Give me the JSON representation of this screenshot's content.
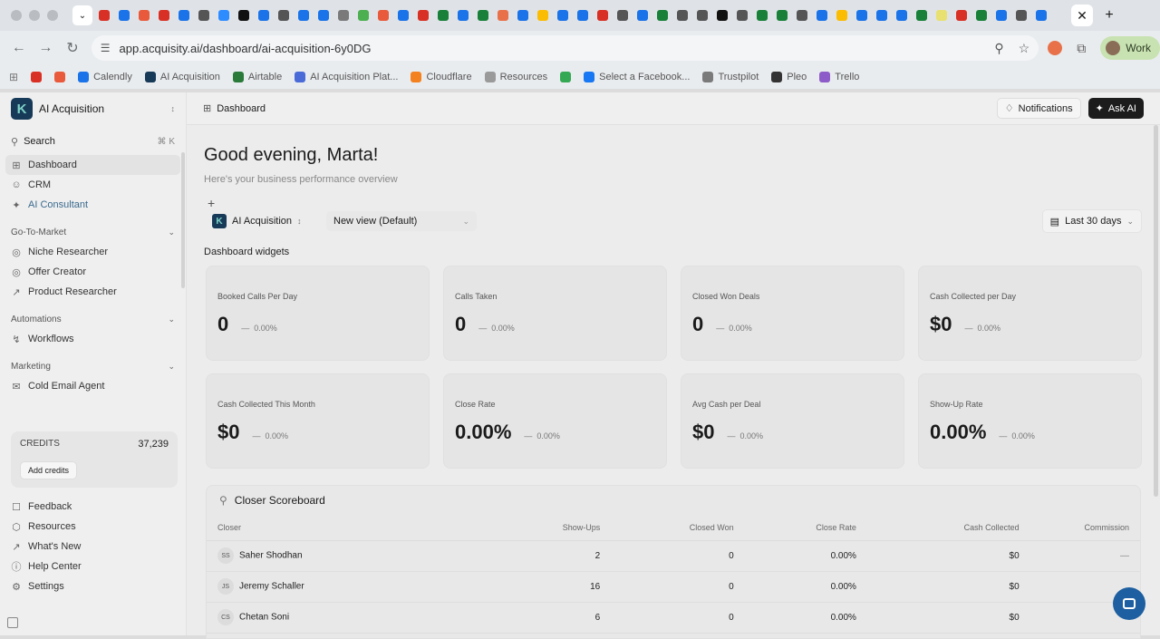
{
  "browser": {
    "tab_colors": [
      "#d93025",
      "#1a73e8",
      "#e85a3b",
      "#d93025",
      "#1a73e8",
      "#555555",
      "#2d8cff",
      "#111111",
      "#1a73e8",
      "#555555",
      "#1a73e8",
      "#1a73e8",
      "#7a7a7a",
      "#4caf50",
      "#e85a3b",
      "#1a73e8",
      "#d93025",
      "#188038",
      "#1a73e8",
      "#188038",
      "#e8714a",
      "#1a73e8",
      "#fbbc04",
      "#1a73e8",
      "#1a73e8",
      "#d93025",
      "#555555",
      "#1a73e8",
      "#188038",
      "#555555",
      "#555555",
      "#111111",
      "#555555",
      "#188038",
      "#188038",
      "#555555",
      "#1a73e8",
      "#fbbc04",
      "#1a73e8",
      "#1a73e8",
      "#1a73e8",
      "#188038",
      "#e8e070",
      "#d93025",
      "#188038",
      "#1a73e8",
      "#555555",
      "#1a73e8"
    ],
    "url": "app.acquisity.ai/dashboard/ai-acquisition-6y0DG",
    "profile_label": "Work",
    "bookmarks": [
      {
        "label": "",
        "color": "#d93025",
        "icon": "gmail-icon"
      },
      {
        "label": "",
        "color": "#e85a3b",
        "icon": "slack-icon"
      },
      {
        "label": "Calendly",
        "color": "#1a73e8",
        "icon": "calendly-icon"
      },
      {
        "label": "AI Acquisition",
        "color": "#173a58",
        "icon": "ai-acquisition-icon"
      },
      {
        "label": "Airtable",
        "color": "#2a7a3a",
        "icon": "airtable-icon"
      },
      {
        "label": "AI Acquisition Plat...",
        "color": "#4a6ad8",
        "icon": "platform-icon"
      },
      {
        "label": "Cloudflare",
        "color": "#f48120",
        "icon": "cloudflare-icon"
      },
      {
        "label": "Resources",
        "color": "#9a9a9a",
        "icon": "folder-icon"
      },
      {
        "label": "",
        "color": "#34a853",
        "icon": "drive-icon"
      },
      {
        "label": "Select a Facebook...",
        "color": "#1877f2",
        "icon": "meta-icon"
      },
      {
        "label": "Trustpilot",
        "color": "#7a7a7a",
        "icon": "trustpilot-icon"
      },
      {
        "label": "Pleo",
        "color": "#333333",
        "icon": "pleo-icon"
      },
      {
        "label": "Trello",
        "color": "#8e5cc8",
        "icon": "trello-icon"
      }
    ]
  },
  "sidebar": {
    "workspace_name": "AI Acquisition",
    "search_label": "Search",
    "search_shortcut": "⌘ K",
    "top_items": [
      {
        "label": "Dashboard",
        "icon": "dashboard-icon"
      },
      {
        "label": "CRM",
        "icon": "users-icon"
      },
      {
        "label": "AI Consultant",
        "icon": "sparkle-icon"
      }
    ],
    "gtm_header": "Go-To-Market",
    "gtm_items": [
      {
        "label": "Niche Researcher",
        "icon": "compass-icon"
      },
      {
        "label": "Offer Creator",
        "icon": "offer-icon"
      },
      {
        "label": "Product Researcher",
        "icon": "telescope-icon"
      }
    ],
    "automations_header": "Automations",
    "automations_items": [
      {
        "label": "Workflows",
        "icon": "workflow-icon"
      }
    ],
    "marketing_header": "Marketing",
    "marketing_items": [
      {
        "label": "Cold Email Agent",
        "icon": "mail-icon"
      }
    ],
    "credits_label": "CREDITS",
    "credits_value": "37,239",
    "add_credits": "Add credits",
    "footer_items": [
      {
        "label": "Feedback",
        "icon": "feedback-icon"
      },
      {
        "label": "Resources",
        "icon": "box-icon"
      },
      {
        "label": "What's New",
        "icon": "megaphone-icon"
      },
      {
        "label": "Help Center",
        "icon": "help-icon"
      },
      {
        "label": "Settings",
        "icon": "gear-icon"
      }
    ]
  },
  "topbar": {
    "breadcrumb": "Dashboard",
    "notifications": "Notifications",
    "ask_ai": "Ask AI"
  },
  "main": {
    "greeting": "Good evening, Marta!",
    "subtitle": "Here's your business performance overview",
    "workspace_select": "AI Acquisition",
    "view_select": "New view (Default)",
    "date_range": "Last 30 days",
    "widgets_header": "Dashboard widgets",
    "widgets": [
      {
        "label": "Booked Calls Per Day",
        "value": "0",
        "delta": "0.00%"
      },
      {
        "label": "Calls Taken",
        "value": "0",
        "delta": "0.00%"
      },
      {
        "label": "Closed Won Deals",
        "value": "0",
        "delta": "0.00%"
      },
      {
        "label": "Cash Collected per Day",
        "value": "$0",
        "delta": "0.00%"
      },
      {
        "label": "Cash Collected This Month",
        "value": "$0",
        "delta": "0.00%"
      },
      {
        "label": "Close Rate",
        "value": "0.00%",
        "delta": "0.00%"
      },
      {
        "label": "Avg Cash per Deal",
        "value": "$0",
        "delta": "0.00%"
      },
      {
        "label": "Show-Up Rate",
        "value": "0.00%",
        "delta": "0.00%"
      }
    ],
    "scoreboard": {
      "title": "Closer Scoreboard",
      "columns": [
        "Closer",
        "Show-Ups",
        "Closed Won",
        "Close Rate",
        "Cash Collected",
        "Commission"
      ],
      "rows": [
        {
          "initials": "SS",
          "name": "Saher Shodhan",
          "show_ups": "2",
          "closed_won": "0",
          "close_rate": "0.00%",
          "cash": "$0",
          "commission": "—"
        },
        {
          "initials": "JS",
          "name": "Jeremy Schaller",
          "show_ups": "16",
          "closed_won": "0",
          "close_rate": "0.00%",
          "cash": "$0",
          "commission": ""
        },
        {
          "initials": "CS",
          "name": "Chetan Soni",
          "show_ups": "6",
          "closed_won": "0",
          "close_rate": "0.00%",
          "cash": "$0",
          "commission": ""
        }
      ]
    }
  }
}
